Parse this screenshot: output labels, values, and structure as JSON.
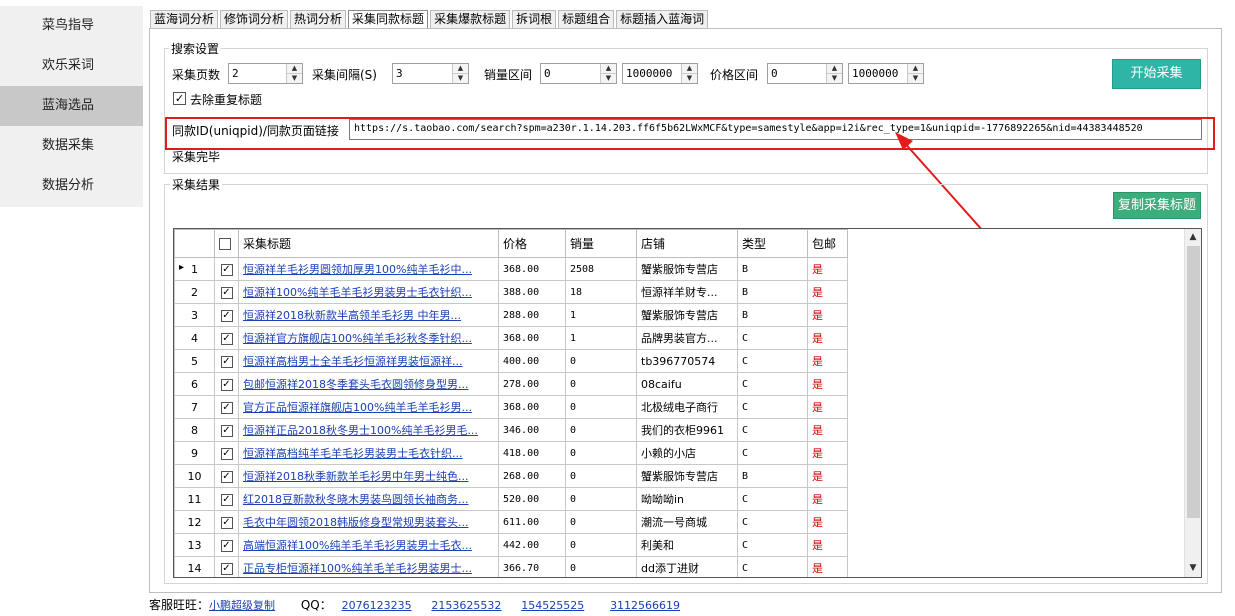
{
  "sidebar": {
    "items": [
      {
        "label": "菜鸟指导",
        "active": false
      },
      {
        "label": "欢乐采词",
        "active": false
      },
      {
        "label": "蓝海选品",
        "active": true
      },
      {
        "label": "数据采集",
        "active": false
      },
      {
        "label": "数据分析",
        "active": false
      }
    ]
  },
  "tabs": [
    {
      "label": "蓝海词分析",
      "active": false
    },
    {
      "label": "修饰词分析",
      "active": false
    },
    {
      "label": "热词分析",
      "active": false
    },
    {
      "label": "采集同款标题",
      "active": true
    },
    {
      "label": "采集爆款标题",
      "active": false
    },
    {
      "label": "拆词根",
      "active": false
    },
    {
      "label": "标题组合",
      "active": false
    },
    {
      "label": "标题插入蓝海词",
      "active": false
    }
  ],
  "search": {
    "group_label": "搜索设置",
    "pages_label": "采集页数",
    "pages_value": "2",
    "interval_label": "采集间隔(S)",
    "interval_value": "3",
    "sales_label": "销量区间",
    "sales_min": "0",
    "sales_max": "1000000",
    "price_label": "价格区间",
    "price_min": "0",
    "price_max": "1000000",
    "start_button": "开始采集",
    "dedupe_label": "去除重复标题",
    "dedupe_checked": true,
    "url_label": "同款ID(uniqpid)/同款页面链接",
    "url_value": "https://s.taobao.com/search?spm=a230r.1.14.203.ff6f5b62LWxMCF&type=samestyle&app=i2i&rec_type=1&uniqpid=-1776892265&nid=44383448520",
    "status": "采集完毕"
  },
  "results": {
    "group_label": "采集结果",
    "copy_button": "复制采集标题",
    "columns": [
      "采集标题",
      "价格",
      "销量",
      "店铺",
      "类型",
      "包邮"
    ],
    "rows": [
      {
        "n": "1",
        "title": "恒源祥羊毛衫男圆领加厚男100%纯羊毛衫中...",
        "price": "368.00",
        "sales": "2508",
        "shop": "蟹紫服饰专营店",
        "type": "B",
        "ship": "是"
      },
      {
        "n": "2",
        "title": "恒源祥100%纯羊毛羊毛衫男装男士毛衣针织...",
        "price": "388.00",
        "sales": "18",
        "shop": "恒源祥羊财专...",
        "type": "B",
        "ship": "是"
      },
      {
        "n": "3",
        "title": "恒源祥2018秋新款半高领羊毛衫男 中年男...",
        "price": "288.00",
        "sales": "1",
        "shop": "蟹紫服饰专营店",
        "type": "B",
        "ship": "是"
      },
      {
        "n": "4",
        "title": "恒源祥官方旗舰店100%纯羊毛衫秋冬季针织...",
        "price": "368.00",
        "sales": "1",
        "shop": "品牌男装官方...",
        "type": "C",
        "ship": "是"
      },
      {
        "n": "5",
        "title": "恒源祥高档男士全羊毛衫恒源祥男装恒源祥...",
        "price": "400.00",
        "sales": "0",
        "shop": "tb396770574",
        "type": "C",
        "ship": "是"
      },
      {
        "n": "6",
        "title": "包邮恒源祥2018冬季套头毛衣圆领修身型男...",
        "price": "278.00",
        "sales": "0",
        "shop": "08caifu",
        "type": "C",
        "ship": "是"
      },
      {
        "n": "7",
        "title": "官方正品恒源祥旗舰店100%纯羊毛羊毛衫男...",
        "price": "368.00",
        "sales": "0",
        "shop": "北极绒电子商行",
        "type": "C",
        "ship": "是"
      },
      {
        "n": "8",
        "title": "恒源祥正品2018秋冬男士100%纯羊毛衫男毛...",
        "price": "346.00",
        "sales": "0",
        "shop": "我们的衣柜9961",
        "type": "C",
        "ship": "是"
      },
      {
        "n": "9",
        "title": "恒源祥高档纯羊毛羊毛衫男装男士毛衣针织...",
        "price": "418.00",
        "sales": "0",
        "shop": "小赖的小店",
        "type": "C",
        "ship": "是"
      },
      {
        "n": "10",
        "title": "恒源祥2018秋季新款羊毛衫男中年男士纯色...",
        "price": "268.00",
        "sales": "0",
        "shop": "蟹紫服饰专营店",
        "type": "B",
        "ship": "是"
      },
      {
        "n": "11",
        "title": "红2018豆新款秋冬晓木男装鸟圆领长袖商务...",
        "price": "520.00",
        "sales": "0",
        "shop": "呦呦呦in",
        "type": "C",
        "ship": "是"
      },
      {
        "n": "12",
        "title": "毛衣中年圆领2018韩版修身型常规男装套头...",
        "price": "611.00",
        "sales": "0",
        "shop": "潮流一号商城",
        "type": "C",
        "ship": "是"
      },
      {
        "n": "13",
        "title": "高端恒源祥100%纯羊毛羊毛衫男装男士毛衣...",
        "price": "442.00",
        "sales": "0",
        "shop": "利美和",
        "type": "C",
        "ship": "是"
      },
      {
        "n": "14",
        "title": "正品专柜恒源祥100%纯羊毛羊毛衫男装男士...",
        "price": "366.70",
        "sales": "0",
        "shop": "dd添丁进财",
        "type": "C",
        "ship": "是"
      }
    ]
  },
  "footer": {
    "service_label": "客服旺旺：",
    "service_link": "小鹏超级复制",
    "qq_label": "QQ：",
    "qq_numbers": [
      "2076123235",
      "2153625532",
      "154525525",
      "3112566619"
    ]
  },
  "colors": {
    "start_button": "#2eb5a5",
    "copy_button": "#3cad7c",
    "highlight_frame": "#e31b1b",
    "link": "#1b3fb5",
    "ship_yes": "#d10000"
  }
}
